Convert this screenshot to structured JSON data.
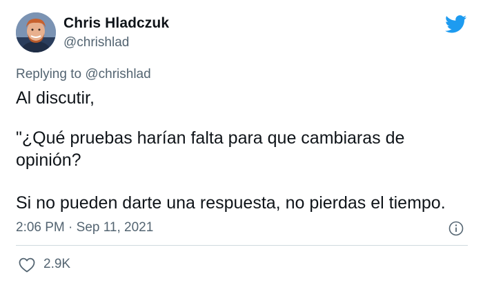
{
  "author": {
    "display_name": "Chris Hladczuk",
    "handle": "@chrishlad",
    "avatar_icon": "profile-photo"
  },
  "brand": {
    "icon": "twitter-bird-icon",
    "color": "#1d9bf0"
  },
  "reply": {
    "prefix": "Replying to",
    "mention": "@chrishlad"
  },
  "tweet": {
    "paragraphs": [
      "Al discutir,",
      "\"¿Qué pruebas harían falta para que cambiaras de opinión?",
      "Si no pueden darte una respuesta, no pierdas el tiempo."
    ]
  },
  "meta": {
    "timestamp": "2:06 PM · Sep 11, 2021",
    "info_icon": "info-icon"
  },
  "engagement": {
    "like_icon": "heart-icon",
    "likes": "2.9K"
  },
  "colors": {
    "text_primary": "#0f1419",
    "text_secondary": "#536471",
    "divider": "#cfd9de"
  }
}
